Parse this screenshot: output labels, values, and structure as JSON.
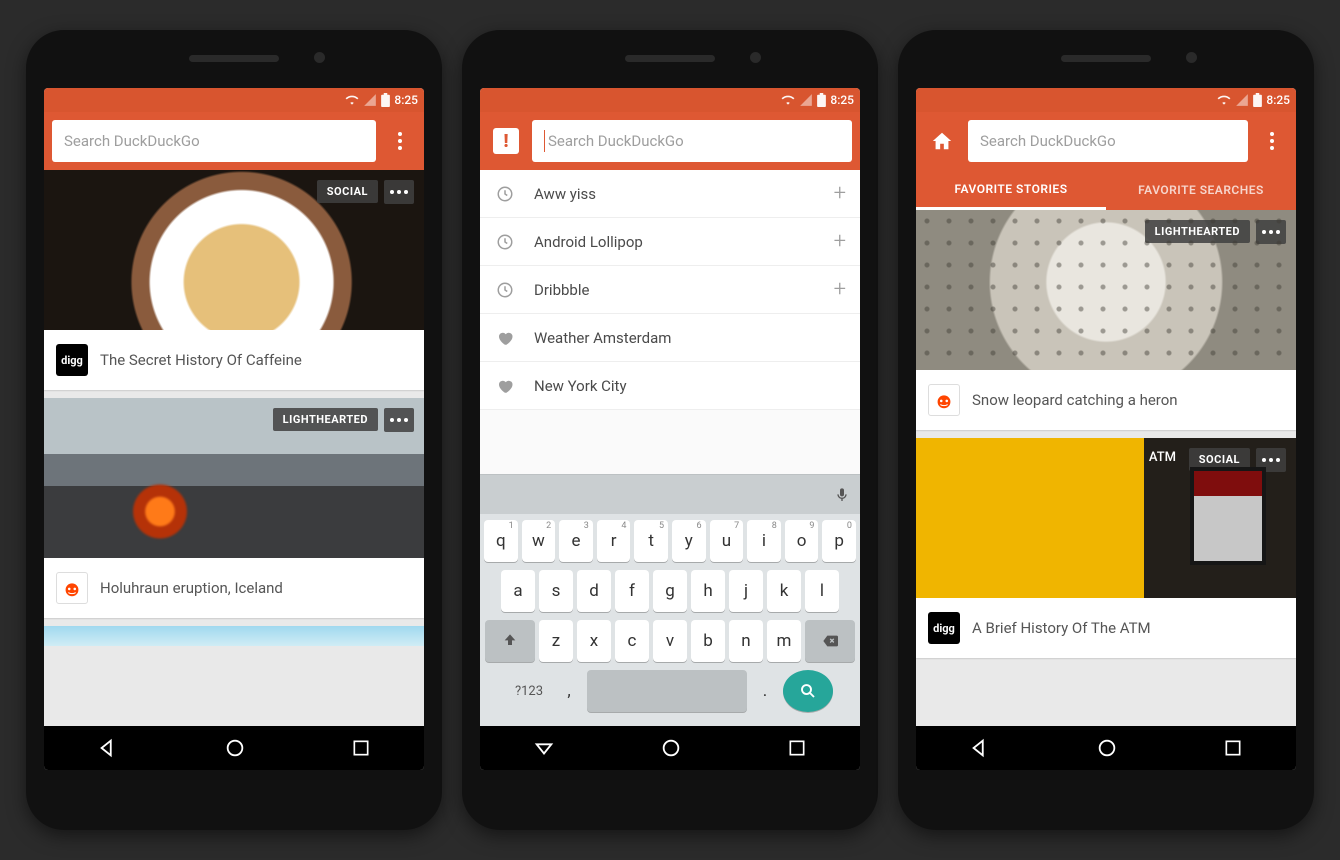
{
  "status": {
    "time": "8:25"
  },
  "search": {
    "placeholder": "Search DuckDuckGo"
  },
  "screen1": {
    "cards": [
      {
        "badge": "SOCIAL",
        "source": "digg",
        "title": "The Secret History Of Caffeine"
      },
      {
        "badge": "LIGHTHEARTED",
        "source": "reddit",
        "title": "Holuhraun eruption, Iceland"
      }
    ]
  },
  "screen2": {
    "suggestions": [
      {
        "type": "recent",
        "text": "Aww yiss"
      },
      {
        "type": "recent",
        "text": "Android Lollipop"
      },
      {
        "type": "recent",
        "text": "Dribbble"
      },
      {
        "type": "favorite",
        "text": "Weather Amsterdam"
      },
      {
        "type": "favorite",
        "text": "New York City"
      }
    ],
    "keyboard": {
      "row1": [
        "q",
        "w",
        "e",
        "r",
        "t",
        "y",
        "u",
        "i",
        "o",
        "p"
      ],
      "row1_super": [
        "1",
        "2",
        "3",
        "4",
        "5",
        "6",
        "7",
        "8",
        "9",
        "0"
      ],
      "row2": [
        "a",
        "s",
        "d",
        "f",
        "g",
        "h",
        "j",
        "k",
        "l"
      ],
      "row3": [
        "z",
        "x",
        "c",
        "v",
        "b",
        "n",
        "m"
      ],
      "sym": "?123",
      "comma": ",",
      "period": "."
    }
  },
  "screen3": {
    "tabs": [
      "FAVORITE STORIES",
      "FAVORITE SEARCHES"
    ],
    "active_tab": 0,
    "cards": [
      {
        "badge": "LIGHTHEARTED",
        "source": "reddit",
        "title": "Snow leopard catching a heron"
      },
      {
        "badge": "SOCIAL",
        "source": "digg",
        "title": "A Brief History Of The ATM",
        "overlay_text": "ATM"
      }
    ]
  }
}
